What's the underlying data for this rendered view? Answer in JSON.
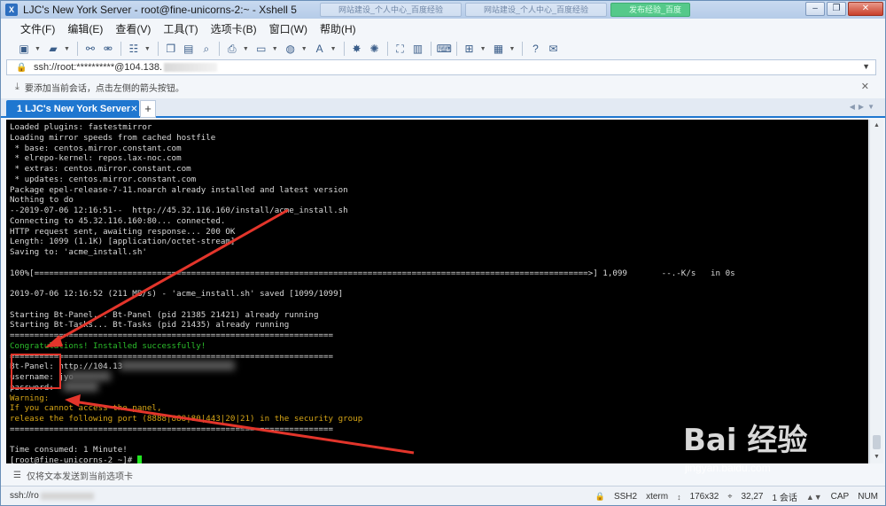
{
  "window": {
    "title": "LJC's New York Server - root@fine-unicorns-2:~ - Xshell 5",
    "ghost_tabs": [
      "网站建设_个人中心_百度经验",
      "网站建设_个人中心_百度经验",
      "发布经验_百度"
    ]
  },
  "menu": [
    "文件(F)",
    "编辑(E)",
    "查看(V)",
    "工具(T)",
    "选项卡(B)",
    "窗口(W)",
    "帮助(H)"
  ],
  "toolbar_icons": [
    "new-session-icon",
    "open-folder-icon",
    "link-icon",
    "unlink-icon",
    "properties-icon",
    "copy-icon",
    "paste-icon",
    "find-icon",
    "print-icon",
    "monitor-icon",
    "globe-icon",
    "font-icon",
    "xftp-icon",
    "xmanager-icon",
    "fullscreen-icon",
    "lock-icon",
    "keyboard-icon",
    "new-tab-icon",
    "layout-icon",
    "help-icon",
    "chat-icon"
  ],
  "address": {
    "text": "ssh://root:**********@104.138."
  },
  "hint": {
    "text": "要添加当前会话，点击左侧的箭头按钮。"
  },
  "tab": {
    "label": "1 LJC's New York Server",
    "close": "✕",
    "add": "+"
  },
  "terminal": {
    "lines": [
      {
        "text": "Loaded plugins: fastestmirror",
        "color": "#d8d8d8"
      },
      {
        "text": "Loading mirror speeds from cached hostfile",
        "color": "#d8d8d8"
      },
      {
        "text": " * base: centos.mirror.constant.com",
        "color": "#d8d8d8"
      },
      {
        "text": " * elrepo-kernel: repos.lax-noc.com",
        "color": "#d8d8d8"
      },
      {
        "text": " * extras: centos.mirror.constant.com",
        "color": "#d8d8d8"
      },
      {
        "text": " * updates: centos.mirror.constant.com",
        "color": "#d8d8d8"
      },
      {
        "text": "Package epel-release-7-11.noarch already installed and latest version",
        "color": "#d8d8d8"
      },
      {
        "text": "Nothing to do",
        "color": "#d8d8d8"
      },
      {
        "text": "--2019-07-06 12:16:51--  http://45.32.116.160/install/acme_install.sh",
        "color": "#d8d8d8"
      },
      {
        "text": "Connecting to 45.32.116.160:80... connected.",
        "color": "#d8d8d8"
      },
      {
        "text": "HTTP request sent, awaiting response... 200 OK",
        "color": "#d8d8d8"
      },
      {
        "text": "Length: 1099 (1.1K) [application/octet-stream]",
        "color": "#d8d8d8"
      },
      {
        "text": "Saving to: 'acme_install.sh'",
        "color": "#d8d8d8"
      },
      {
        "text": "",
        "color": "#d8d8d8"
      },
      {
        "text": "100%[=================================================================================================================>] 1,099       --.-K/s   in 0s",
        "color": "#d8d8d8"
      },
      {
        "text": "",
        "color": "#d8d8d8"
      },
      {
        "text": "2019-07-06 12:16:52 (211 MB/s) - 'acme_install.sh' saved [1099/1099]",
        "color": "#d8d8d8"
      },
      {
        "text": "",
        "color": "#d8d8d8"
      },
      {
        "text": "Starting Bt-Panel... Bt-Panel (pid 21385 21421) already running",
        "color": "#d8d8d8"
      },
      {
        "text": "Starting Bt-Tasks... Bt-Tasks (pid 21435) already running",
        "color": "#d8d8d8"
      },
      {
        "text": "==================================================================",
        "color": "#d8d8d8"
      },
      {
        "text": "Congratulations! Installed successfully!",
        "color": "#2bbd2b"
      },
      {
        "text": "==================================================================",
        "color": "#d8d8d8"
      },
      {
        "text": "Bt-Panel: http://104.13",
        "color": "#d8d8d8"
      },
      {
        "text": "username: jyo",
        "color": "#d8d8d8"
      },
      {
        "text": "password: ",
        "color": "#d8d8d8"
      },
      {
        "text": "Warning:",
        "color": "#d6a516"
      },
      {
        "text": "If you cannot access the panel,",
        "color": "#d6a516"
      },
      {
        "text": "release the following port (8888|888|80|443|20|21) in the security group",
        "color": "#d6a516"
      },
      {
        "text": "==================================================================",
        "color": "#d8d8d8"
      },
      {
        "text": "",
        "color": "#d8d8d8"
      },
      {
        "text": "Time consumed: 1 Minute!",
        "color": "#d8d8d8"
      },
      {
        "text": "[root@fine-unicorns-2 ~]# ",
        "color": "#d8d8d8"
      }
    ]
  },
  "sendbar": {
    "text": "仅将文本发送到当前选项卡"
  },
  "status": {
    "connection": "ssh://ro",
    "protocol": "SSH2",
    "terminal": "xterm",
    "size": "176x32",
    "cursor": "32,27",
    "sessions": "1 会话",
    "caps": "CAP",
    "num": "NUM"
  },
  "watermark": {
    "main": "Bai  经验",
    "sub": "jingyan.baidu.com"
  },
  "colors": {
    "terminal_bg": "#000000",
    "tab_active": "#1f77d0",
    "annotation_red": "#e3352b",
    "success_green": "#2bbd2b",
    "warning_yellow": "#d6a516"
  }
}
